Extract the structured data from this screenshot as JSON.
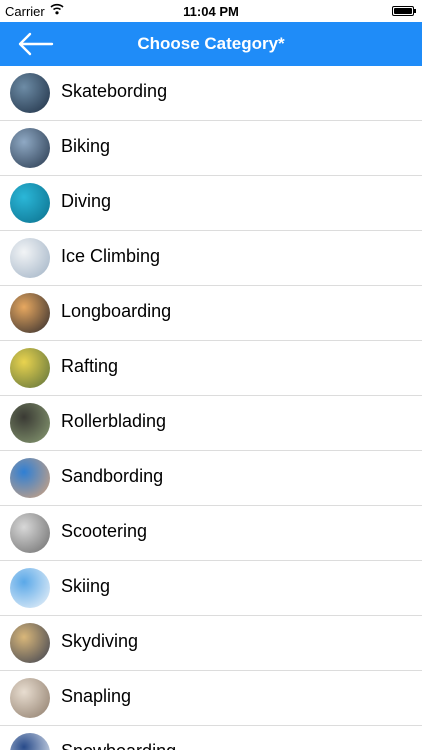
{
  "status_bar": {
    "carrier": "Carrier",
    "time": "11:04 PM"
  },
  "navbar": {
    "title": "Choose Category*",
    "back_icon": "arrow-left-icon"
  },
  "categories": [
    {
      "label": "Skatebording",
      "colors": [
        "#6d8ca6",
        "#1e2f44"
      ]
    },
    {
      "label": "Biking",
      "colors": [
        "#8fa9c4",
        "#27384d"
      ]
    },
    {
      "label": "Diving",
      "colors": [
        "#2bb7d8",
        "#0b6f8c"
      ]
    },
    {
      "label": "Ice Climbing",
      "colors": [
        "#f2f4f6",
        "#9fb1c4"
      ]
    },
    {
      "label": "Longboarding",
      "colors": [
        "#e7a860",
        "#2e2a2c"
      ]
    },
    {
      "label": "Rafting",
      "colors": [
        "#e9d34f",
        "#5a6f3b"
      ]
    },
    {
      "label": "Rollerblading",
      "colors": [
        "#3a3a34",
        "#8a9d74"
      ]
    },
    {
      "label": "Sandbording",
      "colors": [
        "#2f7fd4",
        "#d8a47a"
      ]
    },
    {
      "label": "Scootering",
      "colors": [
        "#d8d8d8",
        "#6c6c6c"
      ]
    },
    {
      "label": "Skiing",
      "colors": [
        "#5aa8e8",
        "#f1f5f9"
      ]
    },
    {
      "label": "Skydiving",
      "colors": [
        "#d9b77a",
        "#3a3f4f"
      ]
    },
    {
      "label": "Snapling",
      "colors": [
        "#e8ddd0",
        "#8d7b6a"
      ]
    },
    {
      "label": "Snowboarding",
      "colors": [
        "#284b8a",
        "#eef2f7"
      ]
    }
  ]
}
